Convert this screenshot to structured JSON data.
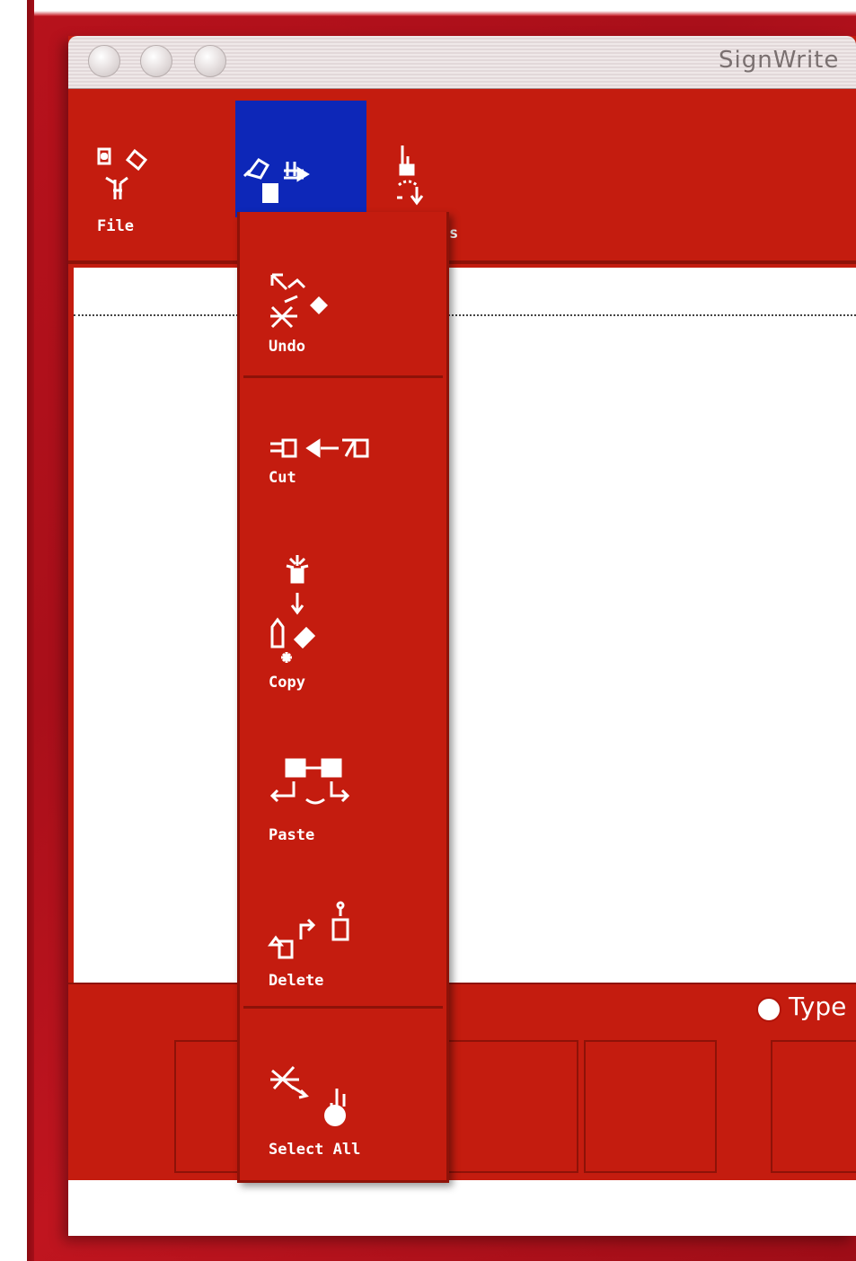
{
  "window": {
    "title": "SignWrite"
  },
  "toolbar": {
    "items": [
      {
        "label": "File",
        "icon": "file-sign-icon"
      },
      {
        "label": "",
        "icon": "edit-sign-icon",
        "active": true
      },
      {
        "label": "s",
        "icon": "view-sign-icon"
      }
    ]
  },
  "edit_menu": {
    "items": [
      {
        "label": "Undo",
        "icon": "undo-sign-icon"
      },
      {
        "label": "Cut",
        "icon": "cut-sign-icon"
      },
      {
        "label": "Copy",
        "icon": "copy-sign-icon"
      },
      {
        "label": "Paste",
        "icon": "paste-sign-icon"
      },
      {
        "label": "Delete",
        "icon": "delete-sign-icon"
      },
      {
        "label": "Select All",
        "icon": "select-all-sign-icon"
      }
    ]
  },
  "status": {
    "radio_label": "Type"
  },
  "colors": {
    "window_red": "#c41c0f",
    "active_blue": "#0d27b8",
    "dark_red": "#8e1208"
  }
}
